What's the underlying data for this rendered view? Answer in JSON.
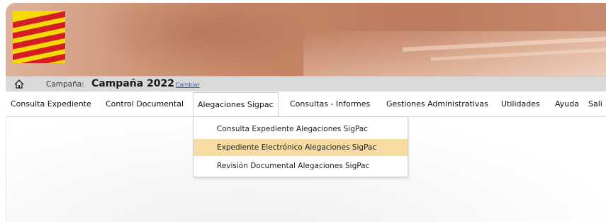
{
  "header": {
    "campaign_label": "Campaña:",
    "campaign_value": "Campaña 2022",
    "change_link": "Cambiar"
  },
  "menu": {
    "items": [
      {
        "label": "Consulta Expediente"
      },
      {
        "label": "Control Documental"
      },
      {
        "label": "Alegaciones Sigpac"
      },
      {
        "label": "Consultas - Informes"
      },
      {
        "label": "Gestiones Administrativas"
      },
      {
        "label": "Utilidades"
      },
      {
        "label": "Ayuda"
      },
      {
        "label": "Sali"
      }
    ],
    "active_index": 2
  },
  "dropdown": {
    "items": [
      {
        "label": "Consulta Expediente Alegaciones SigPac"
      },
      {
        "label": "Expediente Electrónico Alegaciones SigPac"
      },
      {
        "label": "Revisión Documental Alegaciones SigPac"
      }
    ],
    "selected_index": 1
  },
  "icons": {
    "home": "home-icon",
    "logo": "aragon-flag-logo"
  },
  "colors": {
    "highlight": "#f6dca3",
    "flag_yellow": "#f5d90a",
    "flag_red": "#d41d23",
    "link": "#2a5fb3"
  }
}
